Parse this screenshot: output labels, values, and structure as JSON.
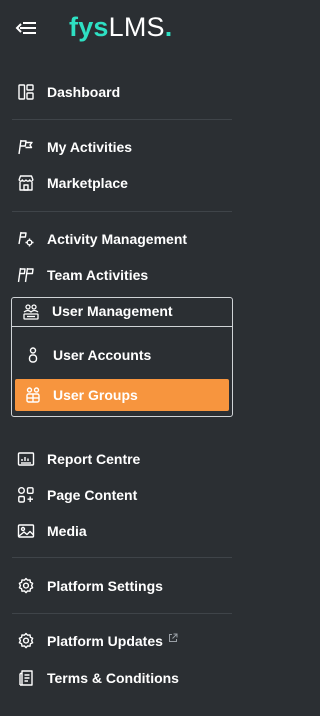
{
  "logo": {
    "part1": "fys",
    "part2": "LMS",
    "part3": "."
  },
  "nav": {
    "dashboard": "Dashboard",
    "my_activities": "My Activities",
    "marketplace": "Marketplace",
    "activity_management": "Activity Management",
    "team_activities": "Team Activities",
    "user_management": "User Management",
    "user_accounts": "User Accounts",
    "user_groups": "User Groups",
    "report_centre": "Report Centre",
    "page_content": "Page Content",
    "media": "Media",
    "platform_settings": "Platform Settings",
    "platform_updates": "Platform Updates",
    "terms_conditions": "Terms & Conditions"
  },
  "icons": {
    "collapse": "collapse-sidebar-icon",
    "dashboard": "dashboard-icon",
    "my_activities": "flag-icon",
    "marketplace": "store-icon",
    "activity_management": "activity-tools-icon",
    "team_activities": "flags-icon",
    "user_management": "users-list-icon",
    "user_accounts": "user-icon",
    "user_groups": "user-groups-icon",
    "report_centre": "report-icon",
    "page_content": "page-content-icon",
    "media": "image-icon",
    "platform_settings": "gear-icon",
    "platform_updates": "gear-icon",
    "external": "external-link-icon",
    "terms_conditions": "document-icon"
  },
  "colors": {
    "background": "#2b2f33",
    "accent": "#2ee0c3",
    "active": "#f7953e",
    "divider": "#3f4449"
  },
  "active_item": "User Groups"
}
